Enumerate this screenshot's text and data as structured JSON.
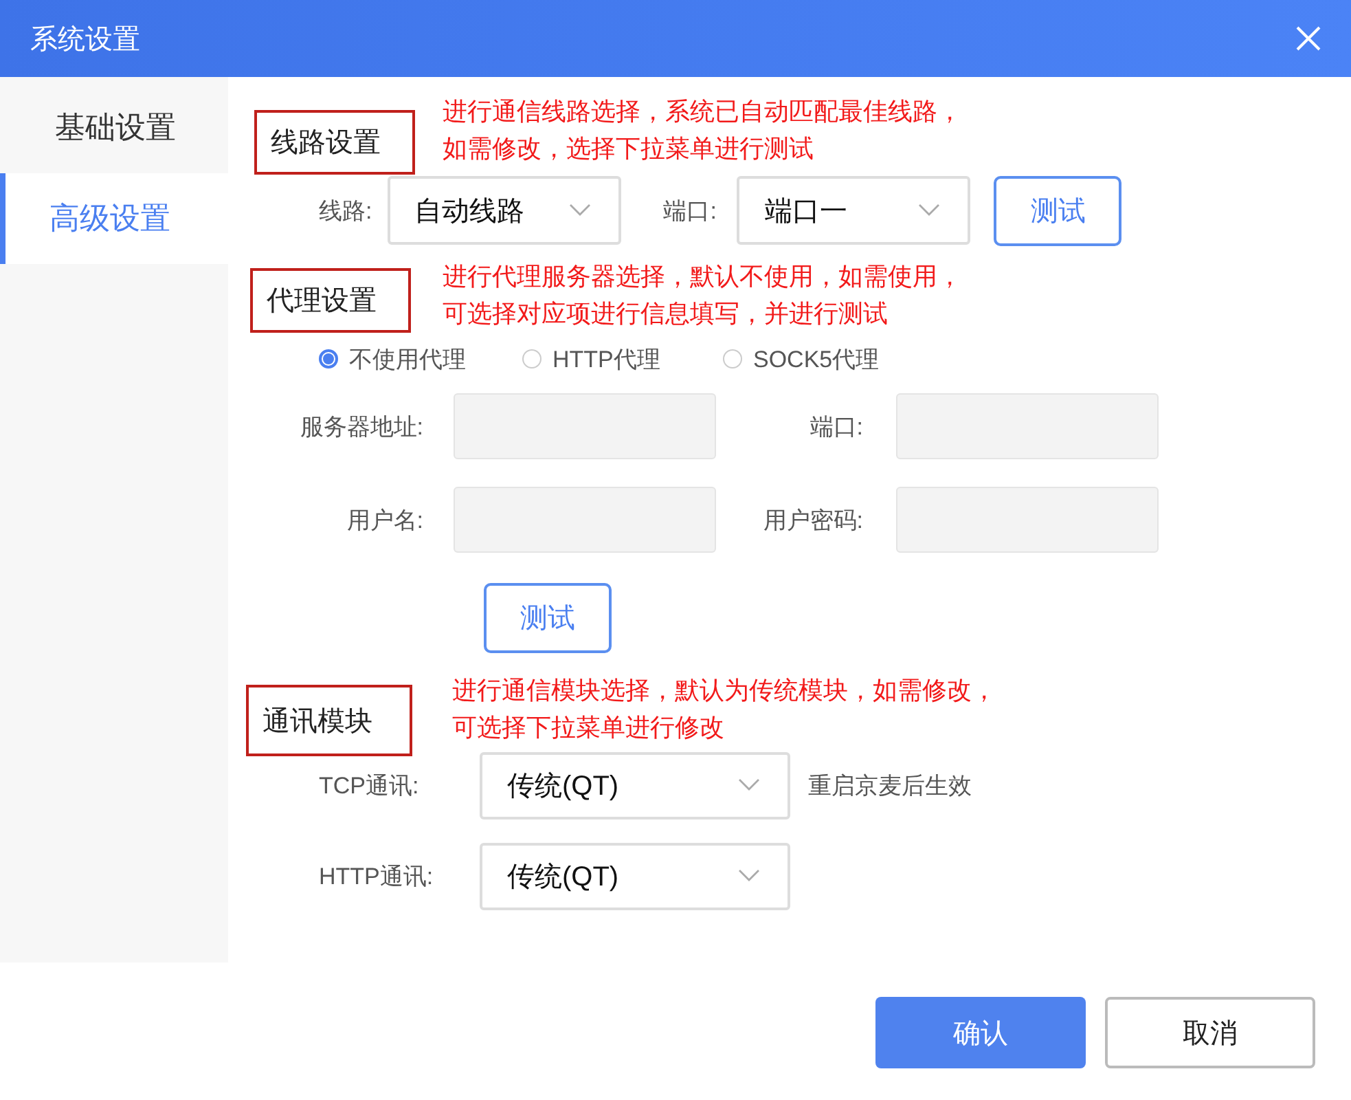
{
  "window": {
    "title": "系统设置"
  },
  "sidebar": {
    "items": [
      {
        "label": "基础设置",
        "selected": false
      },
      {
        "label": "高级设置",
        "selected": true
      }
    ]
  },
  "route": {
    "heading": "线路设置",
    "note": [
      "进行通信线路选择，系统已自动匹配最佳线路，",
      "如需修改，选择下拉菜单进行测试"
    ],
    "fields": [
      {
        "label": "线路:",
        "value": "自动线路"
      },
      {
        "label": "端口:",
        "value": "端口一"
      }
    ],
    "button": "测试"
  },
  "proxy": {
    "heading": "代理设置",
    "note": [
      "进行代理服务器选择，默认不使用，如需使用，",
      "可选择对应项进行信息填写，并进行测试"
    ],
    "options": [
      {
        "label": "不使用代理",
        "selected": true
      },
      {
        "label": "HTTP代理",
        "selected": false
      },
      {
        "label": "SOCK5代理",
        "selected": false
      }
    ],
    "fields": [
      {
        "label": "服务器地址:",
        "disabled": true
      },
      {
        "label": "端口:",
        "disabled": true
      },
      {
        "label": "用户名:",
        "disabled": true
      },
      {
        "label": "用户密码:",
        "disabled": true
      }
    ],
    "button": "测试"
  },
  "comm": {
    "heading": "通讯模块",
    "note": [
      "进行通信模块选择，默认为传统模块，如需修改，",
      "可选择下拉菜单进行修改"
    ],
    "fields": [
      {
        "label": "TCP通讯:",
        "value": "传统(QT)",
        "hint": "重启京麦后生效"
      },
      {
        "label": "HTTP通讯:",
        "value": "传统(QT)"
      }
    ]
  },
  "footer": {
    "buttons": [
      {
        "label": "确认",
        "kind": "primary"
      },
      {
        "label": "取消",
        "kind": "default"
      }
    ]
  }
}
